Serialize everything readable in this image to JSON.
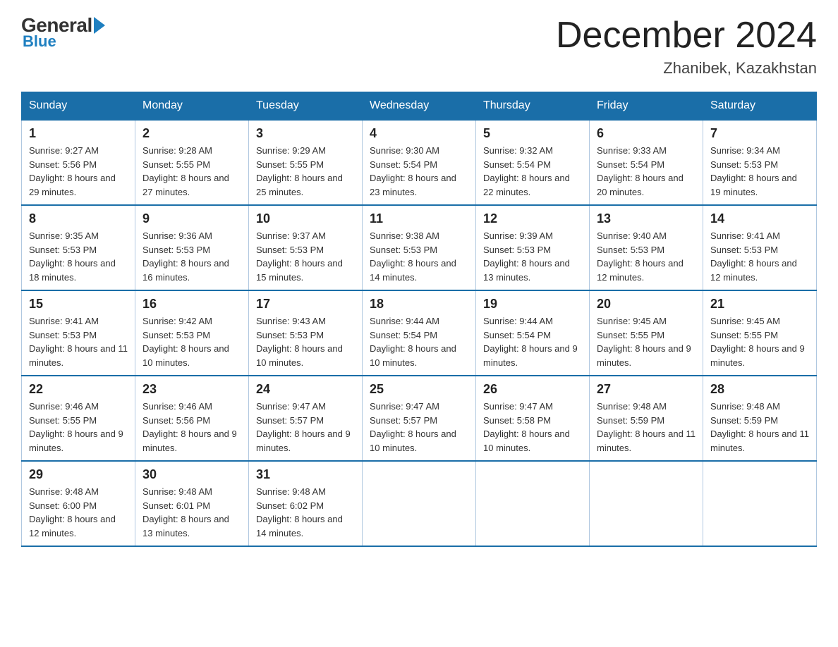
{
  "header": {
    "logo_general": "General",
    "logo_blue": "Blue",
    "month_title": "December 2024",
    "location": "Zhanibek, Kazakhstan"
  },
  "days_of_week": [
    "Sunday",
    "Monday",
    "Tuesday",
    "Wednesday",
    "Thursday",
    "Friday",
    "Saturday"
  ],
  "weeks": [
    [
      {
        "day": "1",
        "sunrise": "9:27 AM",
        "sunset": "5:56 PM",
        "daylight": "8 hours and 29 minutes."
      },
      {
        "day": "2",
        "sunrise": "9:28 AM",
        "sunset": "5:55 PM",
        "daylight": "8 hours and 27 minutes."
      },
      {
        "day": "3",
        "sunrise": "9:29 AM",
        "sunset": "5:55 PM",
        "daylight": "8 hours and 25 minutes."
      },
      {
        "day": "4",
        "sunrise": "9:30 AM",
        "sunset": "5:54 PM",
        "daylight": "8 hours and 23 minutes."
      },
      {
        "day": "5",
        "sunrise": "9:32 AM",
        "sunset": "5:54 PM",
        "daylight": "8 hours and 22 minutes."
      },
      {
        "day": "6",
        "sunrise": "9:33 AM",
        "sunset": "5:54 PM",
        "daylight": "8 hours and 20 minutes."
      },
      {
        "day": "7",
        "sunrise": "9:34 AM",
        "sunset": "5:53 PM",
        "daylight": "8 hours and 19 minutes."
      }
    ],
    [
      {
        "day": "8",
        "sunrise": "9:35 AM",
        "sunset": "5:53 PM",
        "daylight": "8 hours and 18 minutes."
      },
      {
        "day": "9",
        "sunrise": "9:36 AM",
        "sunset": "5:53 PM",
        "daylight": "8 hours and 16 minutes."
      },
      {
        "day": "10",
        "sunrise": "9:37 AM",
        "sunset": "5:53 PM",
        "daylight": "8 hours and 15 minutes."
      },
      {
        "day": "11",
        "sunrise": "9:38 AM",
        "sunset": "5:53 PM",
        "daylight": "8 hours and 14 minutes."
      },
      {
        "day": "12",
        "sunrise": "9:39 AM",
        "sunset": "5:53 PM",
        "daylight": "8 hours and 13 minutes."
      },
      {
        "day": "13",
        "sunrise": "9:40 AM",
        "sunset": "5:53 PM",
        "daylight": "8 hours and 12 minutes."
      },
      {
        "day": "14",
        "sunrise": "9:41 AM",
        "sunset": "5:53 PM",
        "daylight": "8 hours and 12 minutes."
      }
    ],
    [
      {
        "day": "15",
        "sunrise": "9:41 AM",
        "sunset": "5:53 PM",
        "daylight": "8 hours and 11 minutes."
      },
      {
        "day": "16",
        "sunrise": "9:42 AM",
        "sunset": "5:53 PM",
        "daylight": "8 hours and 10 minutes."
      },
      {
        "day": "17",
        "sunrise": "9:43 AM",
        "sunset": "5:53 PM",
        "daylight": "8 hours and 10 minutes."
      },
      {
        "day": "18",
        "sunrise": "9:44 AM",
        "sunset": "5:54 PM",
        "daylight": "8 hours and 10 minutes."
      },
      {
        "day": "19",
        "sunrise": "9:44 AM",
        "sunset": "5:54 PM",
        "daylight": "8 hours and 9 minutes."
      },
      {
        "day": "20",
        "sunrise": "9:45 AM",
        "sunset": "5:55 PM",
        "daylight": "8 hours and 9 minutes."
      },
      {
        "day": "21",
        "sunrise": "9:45 AM",
        "sunset": "5:55 PM",
        "daylight": "8 hours and 9 minutes."
      }
    ],
    [
      {
        "day": "22",
        "sunrise": "9:46 AM",
        "sunset": "5:55 PM",
        "daylight": "8 hours and 9 minutes."
      },
      {
        "day": "23",
        "sunrise": "9:46 AM",
        "sunset": "5:56 PM",
        "daylight": "8 hours and 9 minutes."
      },
      {
        "day": "24",
        "sunrise": "9:47 AM",
        "sunset": "5:57 PM",
        "daylight": "8 hours and 9 minutes."
      },
      {
        "day": "25",
        "sunrise": "9:47 AM",
        "sunset": "5:57 PM",
        "daylight": "8 hours and 10 minutes."
      },
      {
        "day": "26",
        "sunrise": "9:47 AM",
        "sunset": "5:58 PM",
        "daylight": "8 hours and 10 minutes."
      },
      {
        "day": "27",
        "sunrise": "9:48 AM",
        "sunset": "5:59 PM",
        "daylight": "8 hours and 11 minutes."
      },
      {
        "day": "28",
        "sunrise": "9:48 AM",
        "sunset": "5:59 PM",
        "daylight": "8 hours and 11 minutes."
      }
    ],
    [
      {
        "day": "29",
        "sunrise": "9:48 AM",
        "sunset": "6:00 PM",
        "daylight": "8 hours and 12 minutes."
      },
      {
        "day": "30",
        "sunrise": "9:48 AM",
        "sunset": "6:01 PM",
        "daylight": "8 hours and 13 minutes."
      },
      {
        "day": "31",
        "sunrise": "9:48 AM",
        "sunset": "6:02 PM",
        "daylight": "8 hours and 14 minutes."
      },
      null,
      null,
      null,
      null
    ]
  ],
  "labels": {
    "sunrise": "Sunrise:",
    "sunset": "Sunset:",
    "daylight": "Daylight:"
  }
}
